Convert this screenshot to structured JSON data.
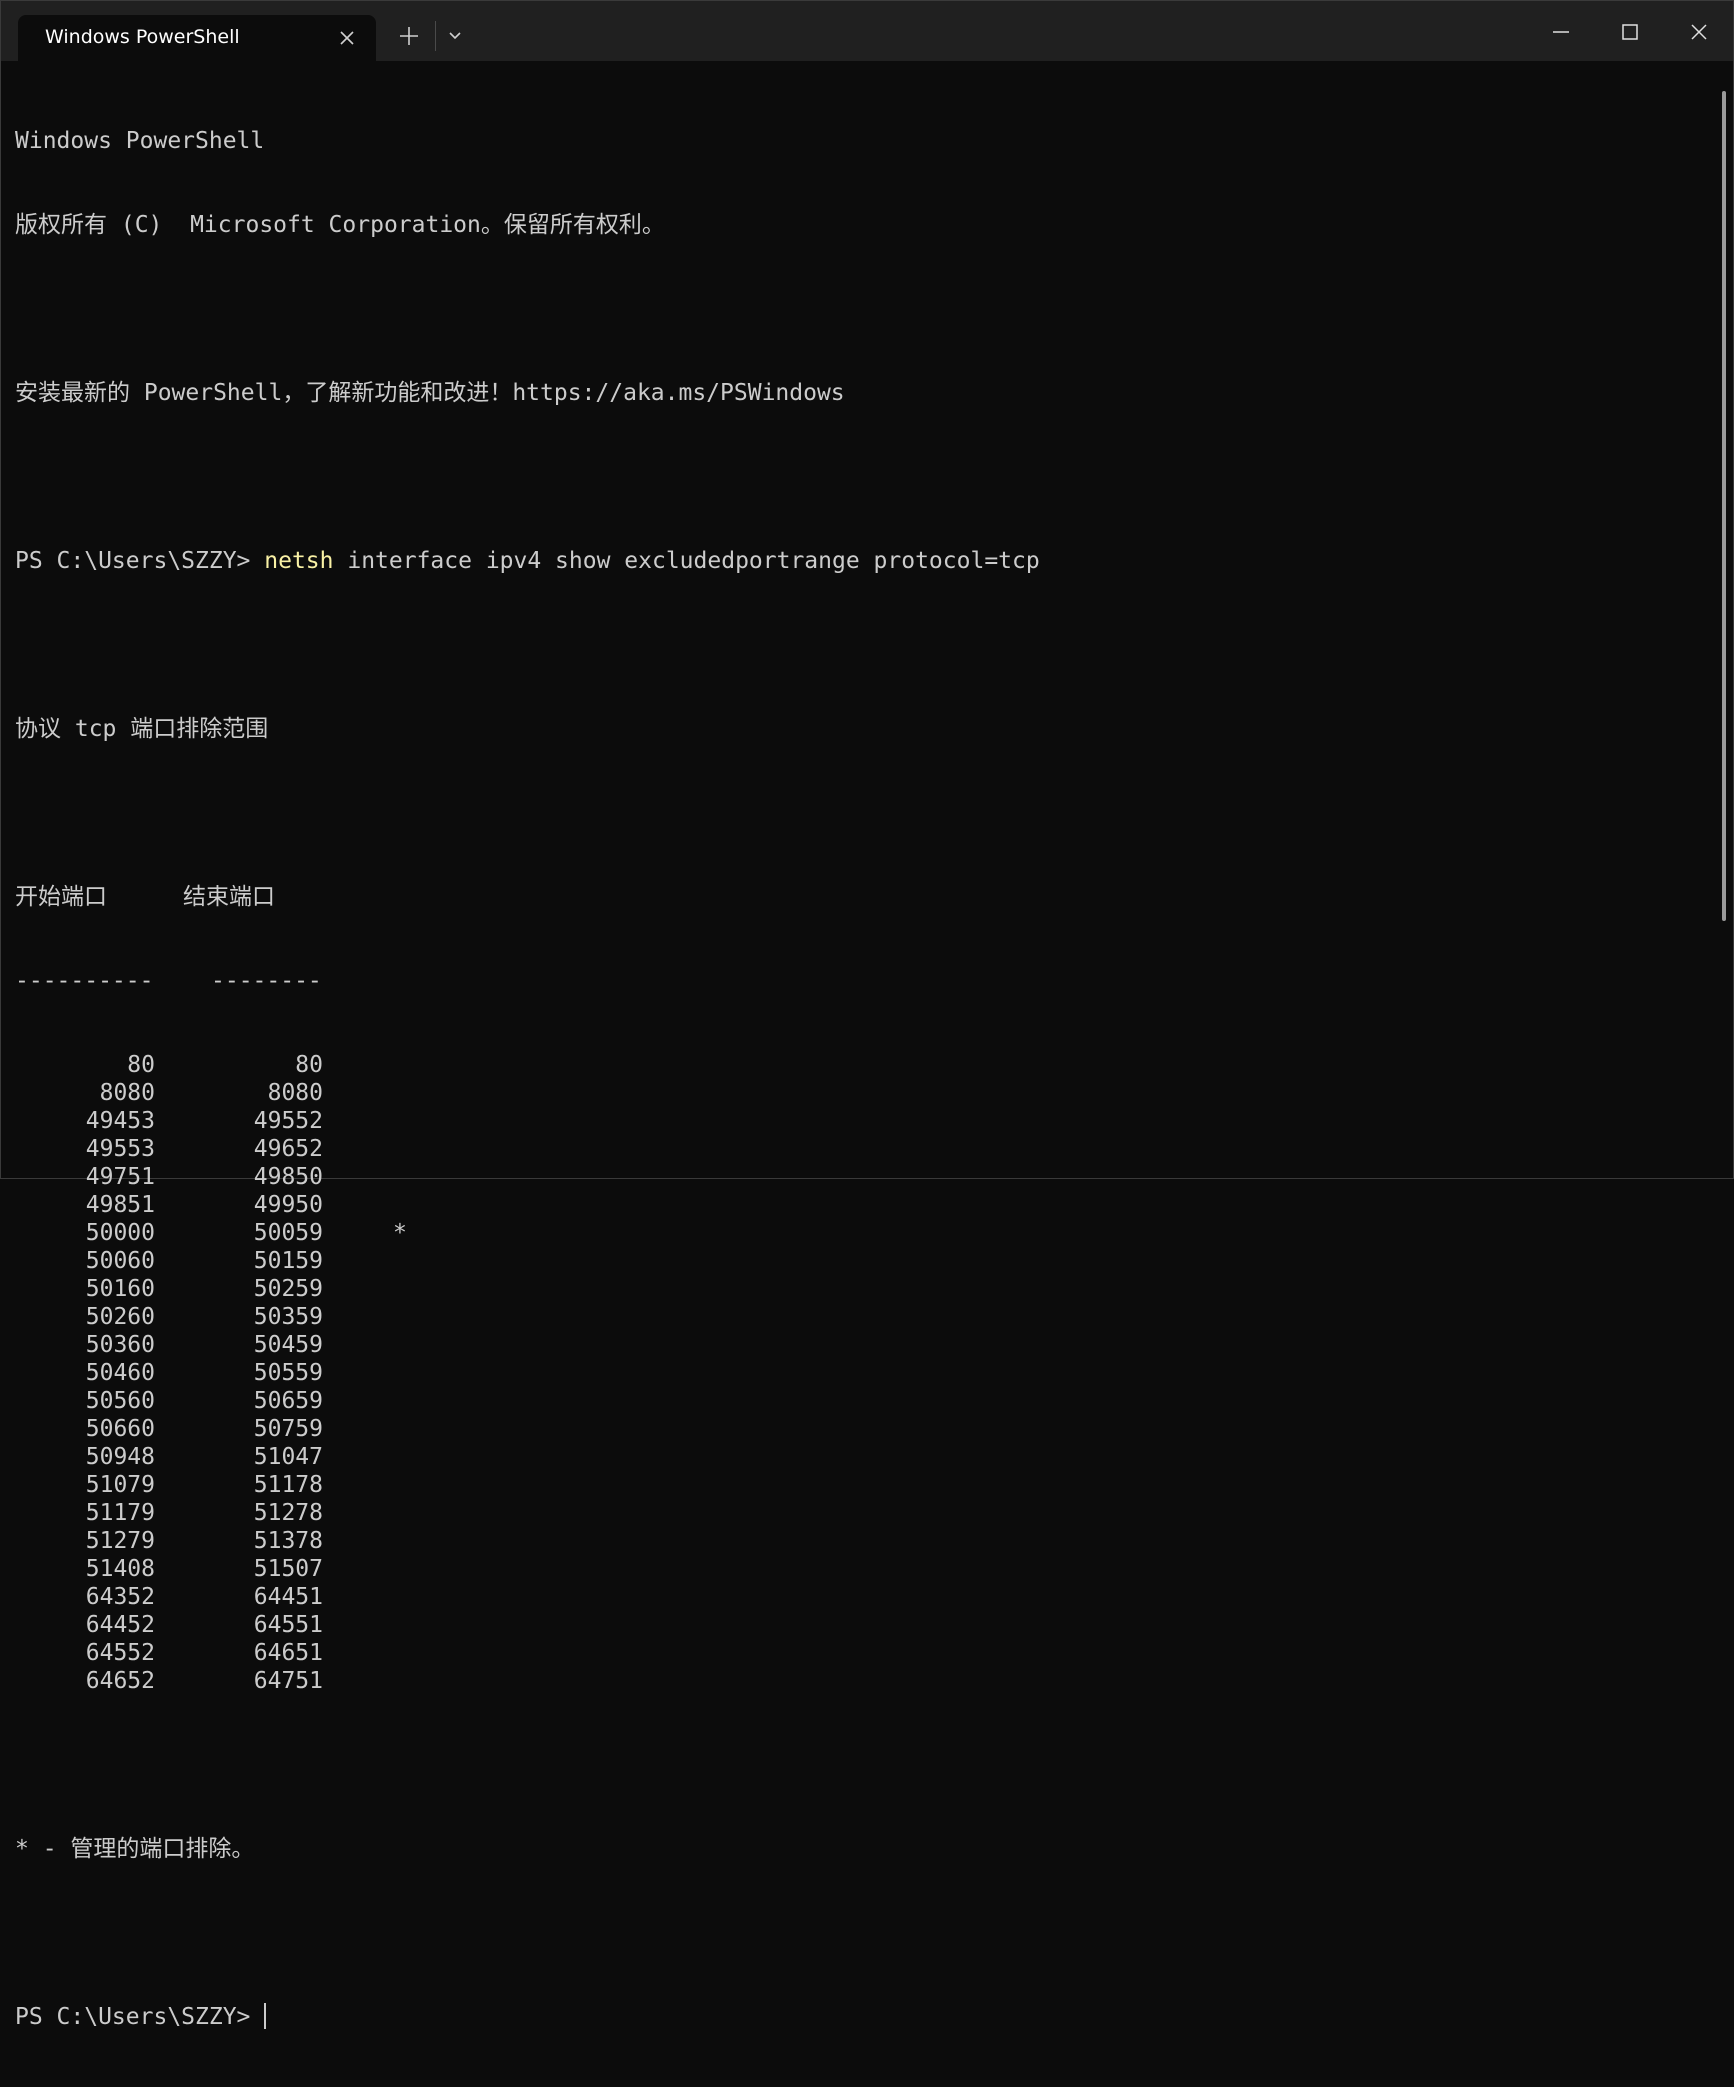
{
  "titlebar": {
    "tab_title": "Windows PowerShell",
    "icons": {
      "tab_close": "close-icon",
      "new_tab": "plus-icon",
      "dropdown": "chevron-down-icon",
      "minimize": "minimize-icon",
      "maximize": "maximize-icon",
      "close": "close-icon"
    }
  },
  "terminal": {
    "header_line1": "Windows PowerShell",
    "header_line2": "版权所有 (C)  Microsoft Corporation。保留所有权利。",
    "install_hint": "安装最新的 PowerShell，了解新功能和改进！https://aka.ms/PSWindows",
    "prompt": "PS C:\\Users\\SZZY> ",
    "command_keyword": "netsh",
    "command_args": " interface ipv4 show excludedportrange protocol=tcp",
    "range_title": "协议 tcp 端口排除范围",
    "col_start": "开始端口",
    "col_end": "结束端口",
    "sep_start": "----------",
    "sep_end": "--------",
    "rows": [
      {
        "start": "80",
        "end": "80",
        "flag": ""
      },
      {
        "start": "8080",
        "end": "8080",
        "flag": ""
      },
      {
        "start": "49453",
        "end": "49552",
        "flag": ""
      },
      {
        "start": "49553",
        "end": "49652",
        "flag": ""
      },
      {
        "start": "49751",
        "end": "49850",
        "flag": ""
      },
      {
        "start": "49851",
        "end": "49950",
        "flag": ""
      },
      {
        "start": "50000",
        "end": "50059",
        "flag": "*"
      },
      {
        "start": "50060",
        "end": "50159",
        "flag": ""
      },
      {
        "start": "50160",
        "end": "50259",
        "flag": ""
      },
      {
        "start": "50260",
        "end": "50359",
        "flag": ""
      },
      {
        "start": "50360",
        "end": "50459",
        "flag": ""
      },
      {
        "start": "50460",
        "end": "50559",
        "flag": ""
      },
      {
        "start": "50560",
        "end": "50659",
        "flag": ""
      },
      {
        "start": "50660",
        "end": "50759",
        "flag": ""
      },
      {
        "start": "50948",
        "end": "51047",
        "flag": ""
      },
      {
        "start": "51079",
        "end": "51178",
        "flag": ""
      },
      {
        "start": "51179",
        "end": "51278",
        "flag": ""
      },
      {
        "start": "51279",
        "end": "51378",
        "flag": ""
      },
      {
        "start": "51408",
        "end": "51507",
        "flag": ""
      },
      {
        "start": "64352",
        "end": "64451",
        "flag": ""
      },
      {
        "start": "64452",
        "end": "64551",
        "flag": ""
      },
      {
        "start": "64552",
        "end": "64651",
        "flag": ""
      },
      {
        "start": "64652",
        "end": "64751",
        "flag": ""
      }
    ],
    "footnote": "* - 管理的端口排除。",
    "final_prompt": "PS C:\\Users\\SZZY> "
  },
  "colors": {
    "background": "#0c0c0c",
    "titlebar": "#202020",
    "text": "#cccccc",
    "command_highlight": "#f9f1a5"
  }
}
